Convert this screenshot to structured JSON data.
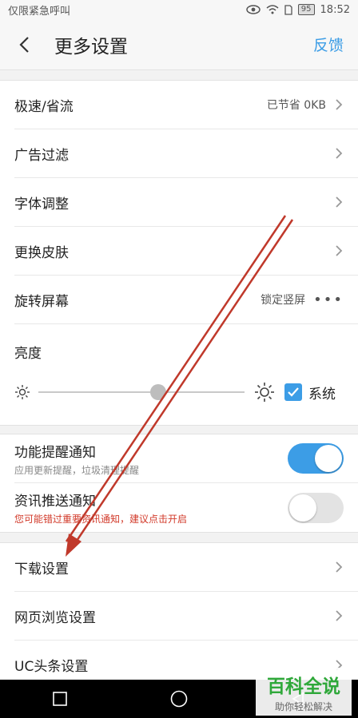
{
  "status_bar": {
    "carrier": "仅限紧急呼叫",
    "battery": "95",
    "time": "18:52"
  },
  "header": {
    "title": "更多设置",
    "feedback": "反馈"
  },
  "settings": [
    {
      "label": "极速/省流",
      "value": "已节省 0KB"
    },
    {
      "label": "广告过滤",
      "value": ""
    },
    {
      "label": "字体调整",
      "value": ""
    },
    {
      "label": "更换皮肤",
      "value": ""
    },
    {
      "label": "旋转屏幕",
      "value": "锁定竖屏"
    }
  ],
  "brightness": {
    "label": "亮度",
    "level": 0.58,
    "system_checked": true,
    "system_label": "系统"
  },
  "notifications": [
    {
      "title": "功能提醒通知",
      "subtitle": "应用更新提醒，垃圾清理提醒",
      "enabled": true
    },
    {
      "title": "资讯推送通知",
      "subtitle": "您可能错过重要资讯通知，建议点击开启",
      "enabled": false
    }
  ],
  "more": [
    {
      "label": "下载设置"
    },
    {
      "label": "网页浏览设置"
    },
    {
      "label": "UC头条设置"
    }
  ],
  "watermark": {
    "main": "百科全说",
    "sub": "助你轻松解决"
  },
  "colors": {
    "accent": "#3c9de6",
    "warning": "#d23a2a",
    "annotation": "#c0392b"
  }
}
